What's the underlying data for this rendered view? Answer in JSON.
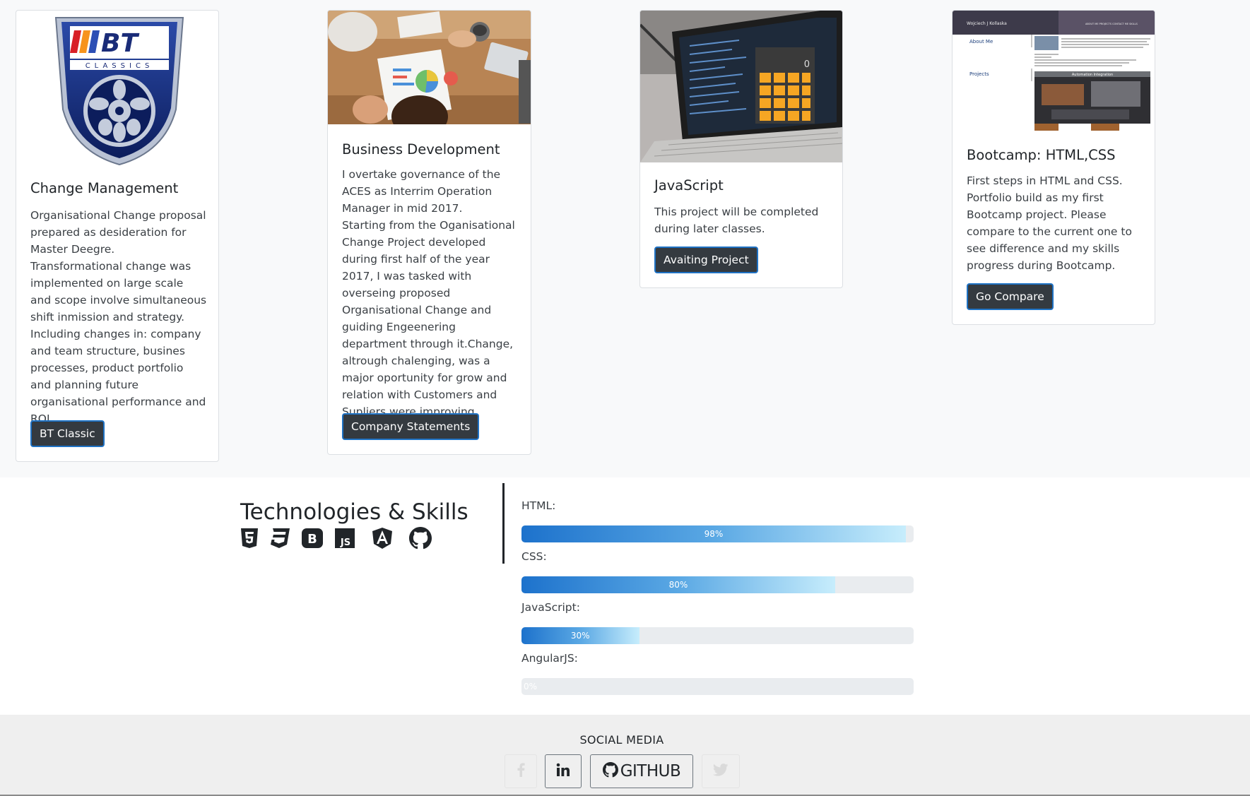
{
  "projects": [
    {
      "title": "Change Management",
      "text": "Organisational Change proposal prepared as desideration for Master Deegre.\nTransformational change was implemented on large scale and scope involve simultaneous shift inmission and strategy. Including changes in: company and team structure, busines processes, product portfolio and planning future organisational performance and ROI.",
      "button": "BT Classic",
      "logo_text": "BT",
      "logo_subtext": "CLASSICS"
    },
    {
      "title": "Business Development",
      "text": "I overtake governance of the ACES as Interrim Operation Manager in mid 2017.\nStarting from the Oganisational Change Project developed during first half of the year 2017, I was tasked with overseing proposed Organisational Change and guiding Engeenering department through it.Change, altrough chalenging, was a major oportunity for grow and relation with Customers and Supliers were improving.",
      "button": "Company Statements"
    },
    {
      "title": "JavaScript",
      "text": "This project will be completed during later classes.",
      "button": "Avaiting Project",
      "calc_display": "0"
    },
    {
      "title": "Bootcamp: HTML,CSS",
      "text": "First steps in HTML and CSS. Portfolio build as my first Bootcamp project. Please compare to the current one to see difference and my skills progress during Bootcamp.",
      "button": "Go Compare",
      "thumb": {
        "brand": "Wojciech J Kollaska",
        "nav": "ABOUT ME   PROJECTS   CONTACT ME   SKILLS",
        "about": "About Me",
        "projects": "Projects",
        "banner": "Automation Integration"
      }
    }
  ],
  "skills": {
    "title": "Technologies & Skills",
    "icons": [
      "html5-icon",
      "css3-icon",
      "bootstrap-icon",
      "javascript-icon",
      "angular-icon",
      "github-icon"
    ],
    "items": [
      {
        "label": "HTML:",
        "percent": 98,
        "text": "98%"
      },
      {
        "label": "CSS:",
        "percent": 80,
        "text": "80%"
      },
      {
        "label": "JavaScript:",
        "percent": 30,
        "text": "30%"
      },
      {
        "label": "AngularJS:",
        "percent": 0,
        "text": "0%"
      }
    ]
  },
  "footer": {
    "title": "SOCIAL MEDIA",
    "github": "GITHUB",
    "social": [
      "facebook-icon",
      "linkedin-icon",
      "github-icon",
      "twitter-icon"
    ]
  },
  "colors": {
    "button_bg": "#343a40",
    "button_border": "#1f72c4",
    "bar_start": "#1d72cc",
    "bar_end": "#c7edfc"
  }
}
